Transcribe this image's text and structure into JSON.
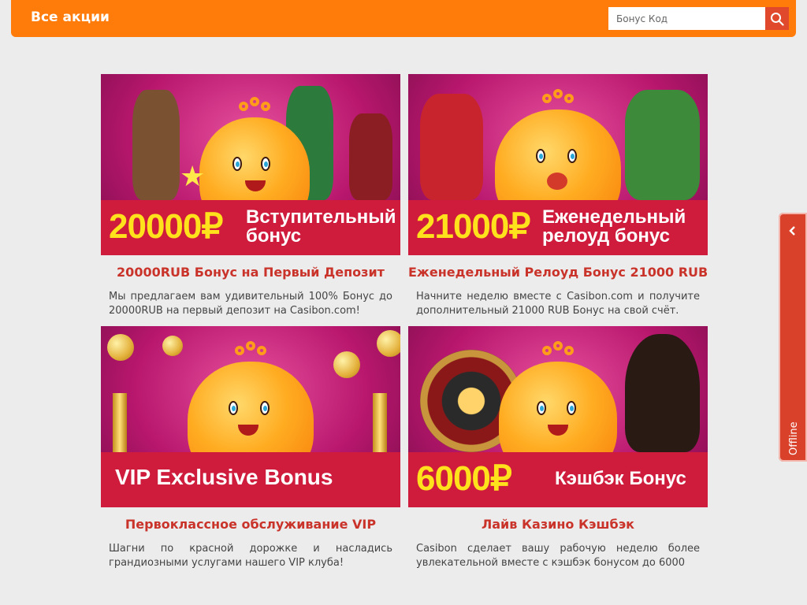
{
  "header": {
    "title": "Все акции",
    "search_placeholder": "Бонус Код"
  },
  "promos": [
    {
      "banner_amount": "20000₽",
      "banner_text_1": "Вступительный",
      "banner_text_2": "бонус",
      "title": "20000RUB Бонус на Первый Депозит",
      "description": "Мы предлагаем вам удивительный 100% Бонус до 20000RUB на первый депозит на Casibon.com!"
    },
    {
      "banner_amount": "21000₽",
      "banner_text_1": "Еженедельный",
      "banner_text_2": "релоуд бонус",
      "title": "Еженедельный Релоуд Бонус 21000 RUB",
      "description": "Начните неделю вместе с Casibon.com и получите дополнительный 21000 RUB Бонус на свой счёт."
    },
    {
      "banner_text_1": "VIP Exclusive Bonus",
      "title": "Первоклассное обслуживание VIP",
      "description": "Шагни по красной дорожке и насладись грандиозными услугами нашего VIP клуба!"
    },
    {
      "banner_amount": "6000₽",
      "banner_text_1": "Кэшбэк Бонус",
      "title": "Лайв Казино Кэшбэк",
      "description": "Casibon сделает вашу рабочую неделю более увлекательной вместе с кэшбэк бонусом до 6000"
    }
  ],
  "chat_tab": {
    "label": "Offline"
  }
}
